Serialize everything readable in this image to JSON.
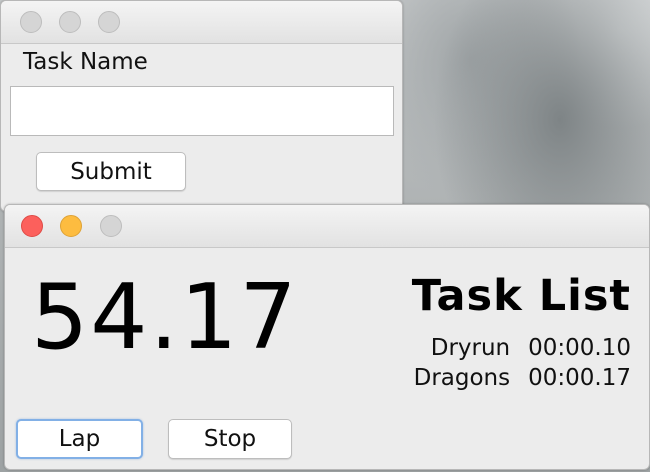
{
  "task_window": {
    "label": "Task Name",
    "input_value": "",
    "submit_label": "Submit"
  },
  "timer_window": {
    "timer_value": "54.17",
    "list_title": "Task List",
    "tasks": [
      {
        "name": "Dryrun",
        "time": "00:00.10"
      },
      {
        "name": "Dragons",
        "time": "00:00.17"
      }
    ],
    "lap_label": "Lap",
    "stop_label": "Stop"
  },
  "colors": {
    "close": "#fc605c",
    "minimize": "#fdbc40",
    "inactive_light": "#d5d5d5",
    "focus_ring": "#82b0e6"
  }
}
